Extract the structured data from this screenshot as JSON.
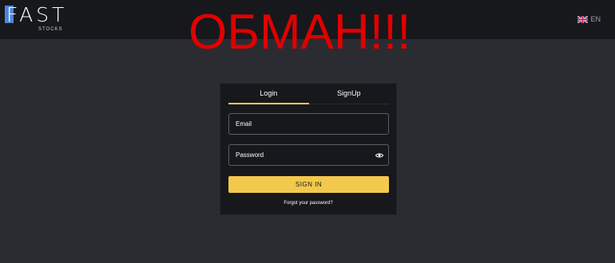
{
  "header": {
    "logo_text": "FAST",
    "logo_subtext": "STOCKS",
    "language_label": "EN"
  },
  "overlay": {
    "text": "ОБМАН!!!"
  },
  "login_card": {
    "tabs": [
      {
        "label": "Login",
        "active": true
      },
      {
        "label": "SignUp",
        "active": false
      }
    ],
    "email": {
      "placeholder": "Email",
      "value": ""
    },
    "password": {
      "placeholder": "Password",
      "value": ""
    },
    "submit_label": "SIGN IN",
    "forgot_label": "Forgot your password?"
  },
  "colors": {
    "background": "#2a2c32",
    "header": "#16181c",
    "card": "#17181c",
    "accent": "#f2c94c",
    "logo_blue": "#4f86d8",
    "overlay_red": "#e00000"
  },
  "icons": [
    "uk-flag-icon",
    "eye-icon"
  ]
}
